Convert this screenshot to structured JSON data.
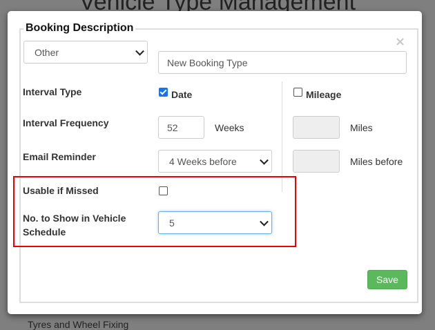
{
  "background": {
    "title": "Vehicle Type Management",
    "row_text": "Tyres and Wheel Fixing"
  },
  "modal": {
    "legend": "Booking Description",
    "close": "×",
    "booking_select": "Other",
    "booking_name_placeholder": "New Booking Type",
    "labels": {
      "interval_type": "Interval Type",
      "interval_frequency": "Interval Frequency",
      "email_reminder": "Email Reminder",
      "usable_if_missed": "Usable if Missed",
      "no_to_show_line1": "No. to Show in Vehicle",
      "no_to_show_line2": "Schedule"
    },
    "date_label": "Date",
    "date_checked": true,
    "mileage_label": "Mileage",
    "mileage_checked": false,
    "frequency_value": "52",
    "frequency_unit": "Weeks",
    "miles_unit": "Miles",
    "email_reminder_value": "4 Weeks before",
    "miles_before_unit": "Miles before",
    "usable_if_missed_checked": false,
    "no_to_show_value": "5",
    "save_label": "Save",
    "highlight_color": "#e00000",
    "accent_color": "#5cb85c"
  }
}
